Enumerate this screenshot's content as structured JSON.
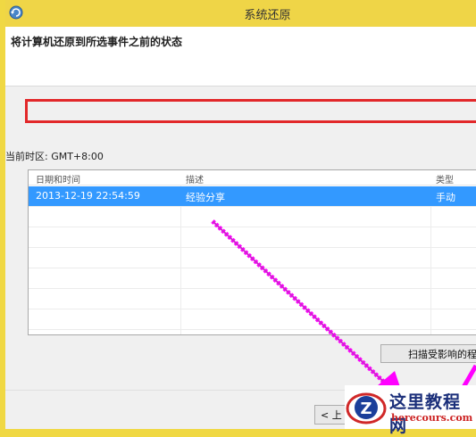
{
  "window": {
    "title": "系统还原"
  },
  "header": {
    "heading": "将计算机还原到所选事件之前的状态"
  },
  "timezone": "当前时区: GMT+8:00",
  "table": {
    "columns": [
      "日期和时间",
      "描述",
      "类型"
    ],
    "rows": [
      {
        "datetime": "2013-12-19 22:54:59",
        "description": "经验分享",
        "type": "手动",
        "selected": true
      }
    ]
  },
  "buttons": {
    "scan": "扫描受影响的程",
    "back": "< 上"
  },
  "watermark": {
    "title": "这里教程网",
    "url": "herecours.com"
  },
  "colors": {
    "titlebar": "#efd547",
    "selection": "#3399ff",
    "highlight": "#e2282a",
    "arrow": "#ff00ff"
  }
}
